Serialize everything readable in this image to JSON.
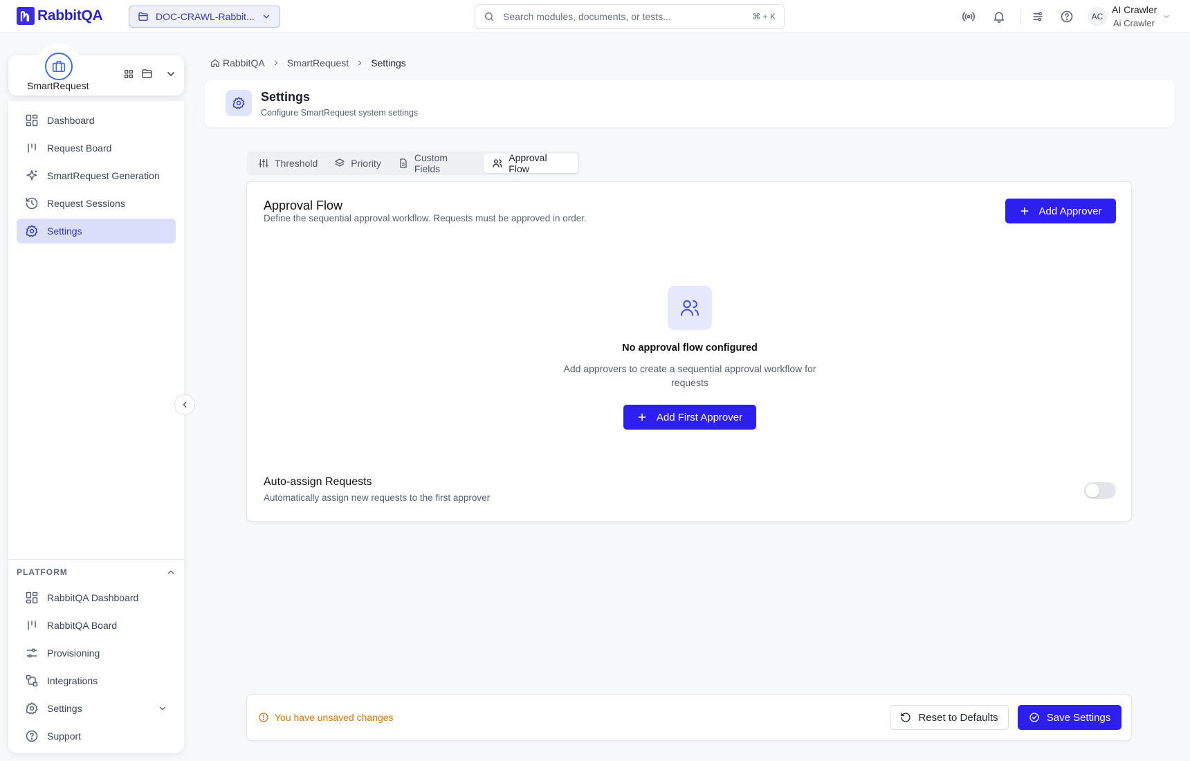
{
  "header": {
    "logo_text": "RabbitQA",
    "project_select": "DOC-CRAWL-Rabbit...",
    "search_placeholder": "Search modules, documents, or tests...",
    "search_shortcut": "⌘ + K",
    "user": {
      "initials": "AC",
      "name": "AI Crawler",
      "subtitle": "Ai Crawler"
    }
  },
  "module": {
    "name": "SmartRequest"
  },
  "sidebar": {
    "items": [
      {
        "label": "Dashboard",
        "icon": "dashboard-icon"
      },
      {
        "label": "Request Board",
        "icon": "board-icon"
      },
      {
        "label": "SmartRequest Generation",
        "icon": "sparkle-icon"
      },
      {
        "label": "Request Sessions",
        "icon": "history-icon"
      },
      {
        "label": "Settings",
        "icon": "gear-icon",
        "active": true
      }
    ],
    "platform_heading": "PLATFORM",
    "platform_items": [
      {
        "label": "RabbitQA Dashboard",
        "icon": "dashboard-icon"
      },
      {
        "label": "RabbitQA Board",
        "icon": "board-icon"
      },
      {
        "label": "Provisioning",
        "icon": "sliders-icon"
      },
      {
        "label": "Integrations",
        "icon": "integration-icon"
      },
      {
        "label": "Settings",
        "icon": "gear-icon"
      },
      {
        "label": "Support",
        "icon": "help-icon"
      }
    ]
  },
  "breadcrumb": [
    "RabbitQA",
    "SmartRequest",
    "Settings"
  ],
  "page": {
    "title": "Settings",
    "subtitle": "Configure SmartRequest system settings"
  },
  "tabs": [
    {
      "label": "Threshold",
      "icon": "sliders-icon"
    },
    {
      "label": "Priority",
      "icon": "layers-icon"
    },
    {
      "label": "Custom Fields",
      "icon": "document-icon"
    },
    {
      "label": "Approval Flow",
      "icon": "users-icon",
      "active": true
    }
  ],
  "approval": {
    "title": "Approval Flow",
    "description": "Define the sequential approval workflow. Requests must be approved in order.",
    "add_button": "Add Approver",
    "empty_title": "No approval flow configured",
    "empty_desc": "Add approvers to create a sequential approval workflow for requests",
    "add_first_button": "Add First Approver",
    "auto_assign_title": "Auto-assign Requests",
    "auto_assign_desc": "Automatically assign new requests to the first approver",
    "auto_assign_enabled": false
  },
  "footer": {
    "unsaved_text": "You have unsaved changes",
    "reset_button": "Reset to Defaults",
    "save_button": "Save Settings"
  },
  "colors": {
    "primary": "#2c1ff0",
    "active_nav_bg": "#dcdffb",
    "warning": "#d97706"
  }
}
